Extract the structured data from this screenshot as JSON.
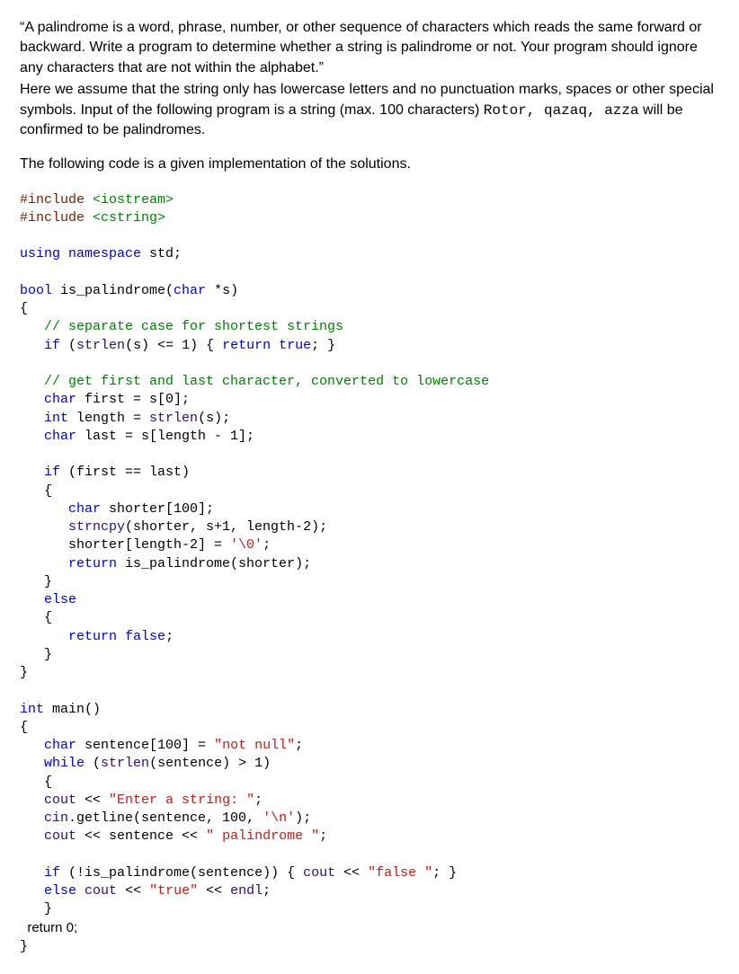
{
  "intro": {
    "p1_a": "“A palindrome is a word, phrase, number, or other sequence of characters which reads the same forward or backward. Write a program to determine whether a string is palindrome or not. Your program should ignore any characters that are not within the alphabet.”",
    "p1_b_a": "Here we assume that the string only has lowercase letters and no punctuation marks, spaces or other special symbols.  Input of the following program is a string (max. 100 characters) ",
    "p1_b_mono": "Rotor, qazaq, azza",
    "p1_b_c": " will be confirmed to be palindromes.",
    "p2": "The following code is a given implementation of the solutions."
  },
  "code": {
    "l01_a": "#include ",
    "l01_b": "<iostream>",
    "l02_a": "#include ",
    "l02_b": "<cstring>",
    "l04_a": "using",
    "l04_b": " ",
    "l04_c": "namespace",
    "l04_d": " std;",
    "l06_a": "bool",
    "l06_b": " is_palindrome(",
    "l06_c": "char",
    "l06_d": " *s)",
    "l07": "{",
    "l08": "   // separate case for shortest strings",
    "l09_a": "   ",
    "l09_b": "if",
    "l09_c": " (",
    "l09_d": "strlen",
    "l09_e": "(s) <= 1) { ",
    "l09_f": "return",
    "l09_g": " ",
    "l09_h": "true",
    "l09_i": "; }",
    "l11": "   // get first and last character, converted to lowercase",
    "l12_a": "   ",
    "l12_b": "char",
    "l12_c": " first = s[0];",
    "l13_a": "   ",
    "l13_b": "int",
    "l13_c": " length = ",
    "l13_d": "strlen",
    "l13_e": "(s);",
    "l14_a": "   ",
    "l14_b": "char",
    "l14_c": " last = s[length - 1];",
    "l16_a": "   ",
    "l16_b": "if",
    "l16_c": " (first == last)",
    "l17": "   {",
    "l18_a": "      ",
    "l18_b": "char",
    "l18_c": " shorter[100];",
    "l19_a": "      ",
    "l19_b": "strncpy",
    "l19_c": "(shorter, s+1, length-2);",
    "l20_a": "      shorter[length-2] = ",
    "l20_b": "'\\0'",
    "l20_c": ";",
    "l21_a": "      ",
    "l21_b": "return",
    "l21_c": " is_palindrome(shorter);",
    "l22": "   }",
    "l23_a": "   ",
    "l23_b": "else",
    "l24": "   {",
    "l25_a": "      ",
    "l25_b": "return",
    "l25_c": " ",
    "l25_d": "false",
    "l25_e": ";",
    "l26": "   }",
    "l27": "}",
    "l29_a": "int",
    "l29_b": " main()",
    "l30": "{",
    "l31_a": "   ",
    "l31_b": "char",
    "l31_c": " sentence[100] = ",
    "l31_d": "\"not null\"",
    "l31_e": ";",
    "l32_a": "   ",
    "l32_b": "while",
    "l32_c": " (",
    "l32_d": "strlen",
    "l32_e": "(sentence) > 1)",
    "l33": "   {",
    "l34_a": "   ",
    "l34_b": "cout",
    "l34_c": " << ",
    "l34_d": "\"Enter a string: \"",
    "l34_e": ";",
    "l35_a": "   ",
    "l35_b": "cin",
    "l35_c": ".getline(sentence, 100, ",
    "l35_d": "'\\n'",
    "l35_e": ");",
    "l36_a": "   ",
    "l36_b": "cout",
    "l36_c": " << sentence << ",
    "l36_d": "\" palindrome \"",
    "l36_e": ";",
    "l38_a": "   ",
    "l38_b": "if",
    "l38_c": " (!is_palindrome(sentence)) { ",
    "l38_d": "cout",
    "l38_e": " << ",
    "l38_f": "\"false \"",
    "l38_g": "; }",
    "l39_a": "   ",
    "l39_b": "else",
    "l39_c": " ",
    "l39_d": "cout",
    "l39_e": " << ",
    "l39_f": "\"true\"",
    "l39_g": " << ",
    "l39_h": "endl",
    "l39_i": ";",
    "l40": "   }",
    "l41": "  return 0;",
    "l42": "}"
  }
}
